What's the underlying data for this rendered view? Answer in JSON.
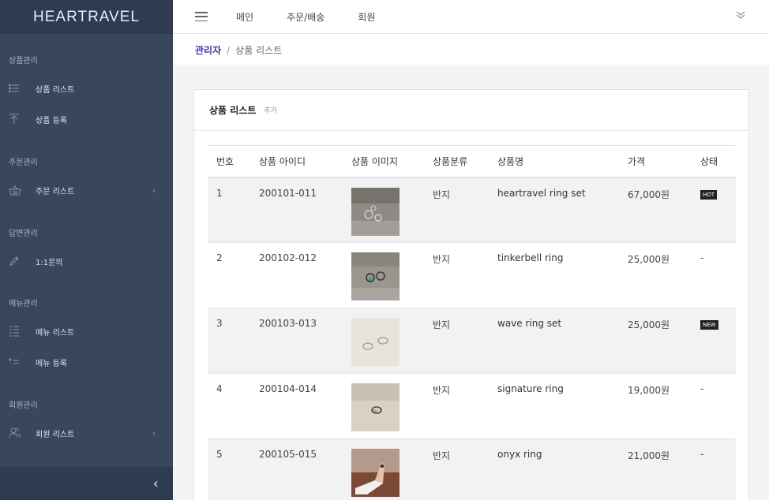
{
  "brand": "HEARTRAVEL",
  "topnav": [
    "메인",
    "주문/배송",
    "회원"
  ],
  "breadcrumb": {
    "root": "관리자",
    "sep": "/",
    "current": "상품 리스트"
  },
  "sidebar": {
    "sections": [
      {
        "title": "상품관리",
        "items": [
          {
            "label": "상품 리스트",
            "icon": "list-icon"
          },
          {
            "label": "상품 등록",
            "icon": "upload-icon"
          }
        ]
      },
      {
        "title": "주문관리",
        "items": [
          {
            "label": "주문 리스트",
            "icon": "basket-icon"
          }
        ]
      },
      {
        "title": "답변관리",
        "items": [
          {
            "label": "1:1문의",
            "icon": "pencil-icon"
          }
        ]
      },
      {
        "title": "메뉴관리",
        "items": [
          {
            "label": "메뉴 리스트",
            "icon": "menu-list-icon"
          },
          {
            "label": "메뉴 등록",
            "icon": "menu-add-icon"
          }
        ]
      },
      {
        "title": "회원관리",
        "items": [
          {
            "label": "회원 리스트",
            "icon": "users-icon"
          }
        ]
      }
    ],
    "collapse": "‹"
  },
  "card": {
    "title": "상품 리스트",
    "add_label": "추가"
  },
  "table": {
    "headers": [
      "번호",
      "상품 아이디",
      "상품 이미지",
      "상품분류",
      "상품명",
      "가격",
      "상태"
    ],
    "rows": [
      {
        "no": "1",
        "id": "200101-011",
        "category": "반지",
        "name": "heartravel ring set",
        "price": "67,000원",
        "status": "HOT"
      },
      {
        "no": "2",
        "id": "200102-012",
        "category": "반지",
        "name": "tinkerbell ring",
        "price": "25,000원",
        "status": "-"
      },
      {
        "no": "3",
        "id": "200103-013",
        "category": "반지",
        "name": "wave ring set",
        "price": "25,000원",
        "status": "NEW"
      },
      {
        "no": "4",
        "id": "200104-014",
        "category": "반지",
        "name": "signature ring",
        "price": "19,000원",
        "status": "-"
      },
      {
        "no": "5",
        "id": "200105-015",
        "category": "반지",
        "name": "onyx ring",
        "price": "21,000원",
        "status": "-"
      }
    ]
  }
}
